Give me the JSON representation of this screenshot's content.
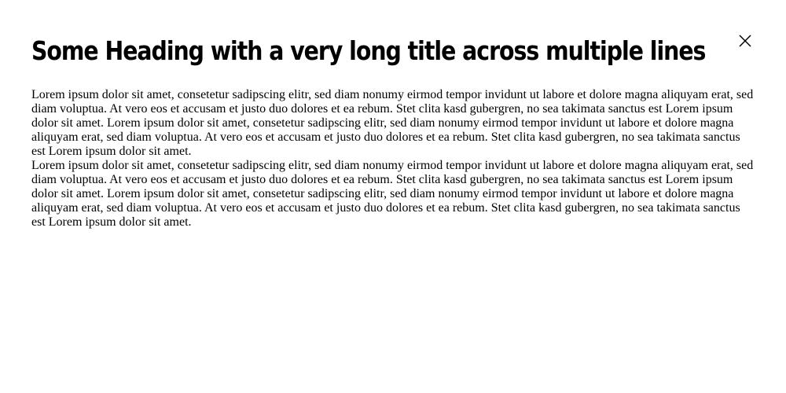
{
  "modal": {
    "heading": "Some Heading with a very long title across multiple lines",
    "close_icon": "close-icon",
    "paragraphs": [
      "Lorem ipsum dolor sit amet, consetetur sadipscing elitr, sed diam nonumy eirmod tempor invidunt ut labore et dolore magna aliquyam erat, sed diam voluptua. At vero eos et accusam et justo duo dolores et ea rebum. Stet clita kasd gubergren, no sea takimata sanctus est Lorem ipsum dolor sit amet. Lorem ipsum dolor sit amet, consetetur sadipscing elitr, sed diam nonumy eirmod tempor invidunt ut labore et dolore magna aliquyam erat, sed diam voluptua. At vero eos et accusam et justo duo dolores et ea rebum. Stet clita kasd gubergren, no sea takimata sanctus est Lorem ipsum dolor sit amet.",
      "Lorem ipsum dolor sit amet, consetetur sadipscing elitr, sed diam nonumy eirmod tempor invidunt ut labore et dolore magna aliquyam erat, sed diam voluptua. At vero eos et accusam et justo duo dolores et ea rebum. Stet clita kasd gubergren, no sea takimata sanctus est Lorem ipsum dolor sit amet. Lorem ipsum dolor sit amet, consetetur sadipscing elitr, sed diam nonumy eirmod tempor invidunt ut labore et dolore magna aliquyam erat, sed diam voluptua. At vero eos et accusam et justo duo dolores et ea rebum. Stet clita kasd gubergren, no sea takimata sanctus est Lorem ipsum dolor sit amet."
    ]
  }
}
